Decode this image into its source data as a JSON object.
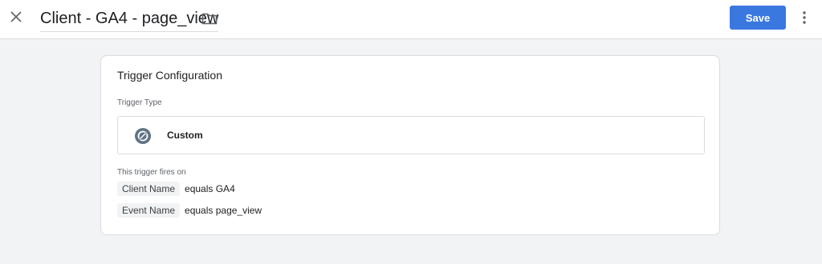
{
  "header": {
    "title": "Client - GA4 - page_view",
    "save_label": "Save",
    "icons": {
      "close": "close-icon",
      "folder": "folder-icon",
      "more": "more-vert-icon"
    },
    "accent_color": "#3a78e0"
  },
  "card": {
    "title": "Trigger Configuration",
    "trigger_type_label": "Trigger Type",
    "trigger_type": {
      "label": "Custom",
      "icon": "custom-trigger-icon"
    },
    "fires_on_label": "This trigger fires on",
    "conditions": [
      {
        "variable": "Client Name",
        "operator": "equals GA4"
      },
      {
        "variable": "Event Name",
        "operator": "equals page_view"
      }
    ]
  }
}
